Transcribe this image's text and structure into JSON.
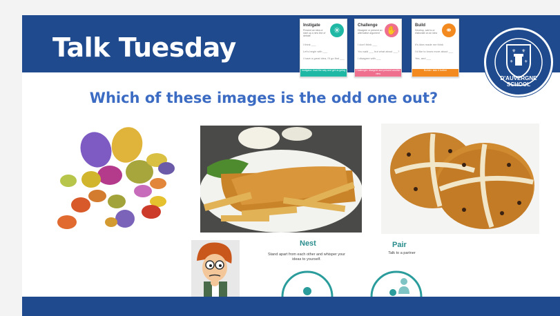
{
  "slide": {
    "title": "Talk Tuesday",
    "question": "Which of these images is the odd one out?"
  },
  "cards": [
    {
      "title": "Instigate",
      "sub": "Present an idea or start up a new line of debate",
      "lines": [
        "I think ___",
        "Let's begin with ___",
        "I have a great idea, I'll go first ___"
      ],
      "foot": "Instigator: lead the way and get us going",
      "color": "#1fb8a5",
      "icon": "star-icon"
    },
    {
      "title": "Challenge",
      "sub": "Disagree or present an alternative argument",
      "lines": [
        "I don't think ___",
        "You said ___ but what about ___?",
        "I disagree with ___"
      ],
      "foot": "Challenger: disagree and present another view",
      "color": "#ef6f8f",
      "icon": "hand-icon"
    },
    {
      "title": "Build",
      "sub": "Develop, add to or elaborate on an idea",
      "lines": [
        "It's idea made me think",
        "I'd like to know more about ___",
        "Yes, and ___"
      ],
      "foot": "Builder: take it further",
      "color": "#f28a1f",
      "icon": "connect-icon"
    }
  ],
  "crest": {
    "text": "D'AUVERGNE SCHOOL"
  },
  "nest": {
    "title": "Nest",
    "desc": "Stand apart from each other and whisper your ideas to yourself."
  },
  "pair": {
    "title": "Pair",
    "desc": "Talk to a partner"
  },
  "colors": {
    "banner": "#1f4b8e",
    "question": "#3b6bc2",
    "teal": "#2a9c9c"
  }
}
